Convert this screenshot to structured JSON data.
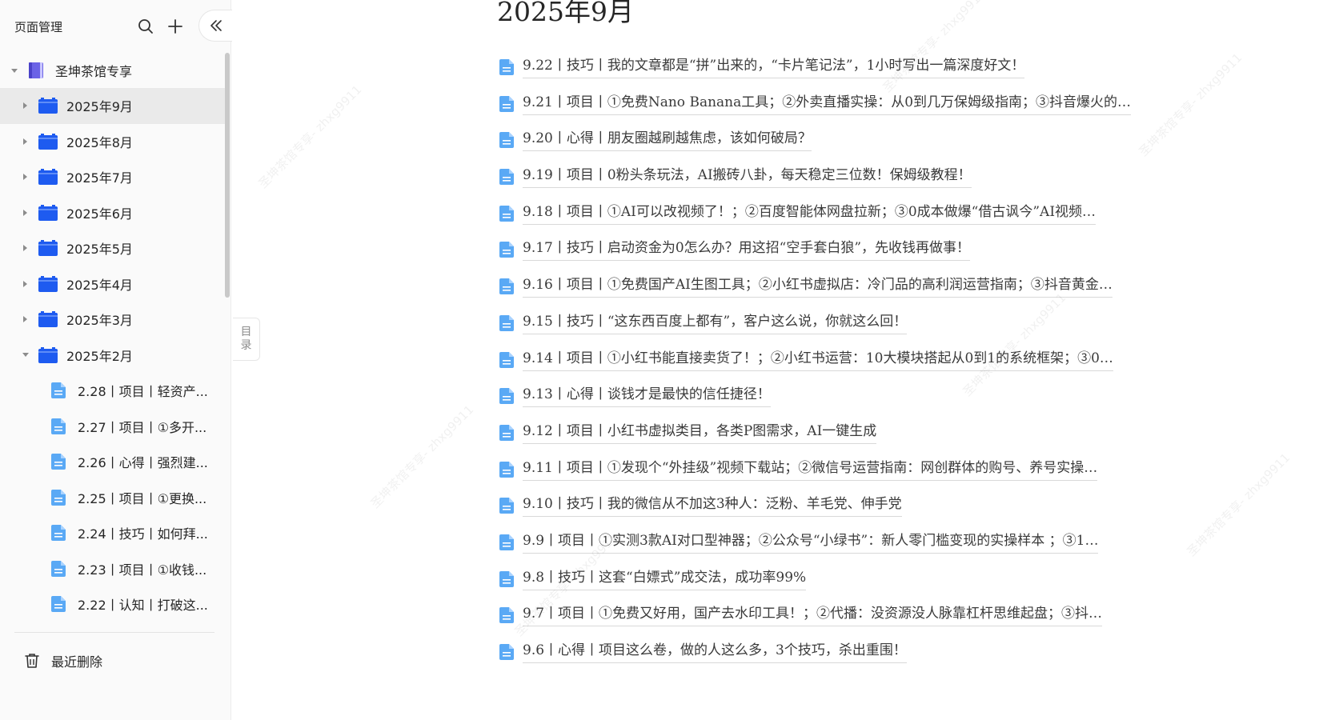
{
  "sidebar": {
    "title": "页面管理",
    "root": {
      "label": "圣坤茶馆专享"
    },
    "folders": [
      {
        "label": "2025年9月"
      },
      {
        "label": "2025年8月"
      },
      {
        "label": "2025年7月"
      },
      {
        "label": "2025年6月"
      },
      {
        "label": "2025年5月"
      },
      {
        "label": "2025年4月"
      },
      {
        "label": "2025年3月"
      },
      {
        "label": "2025年2月"
      }
    ],
    "children": [
      {
        "label": "2.28丨项目丨轻资产..."
      },
      {
        "label": "2.27丨项目丨①多开..."
      },
      {
        "label": "2.26丨心得丨强烈建..."
      },
      {
        "label": "2.25丨项目丨①更换..."
      },
      {
        "label": "2.24丨技巧丨如何拜..."
      },
      {
        "label": "2.23丨项目丨①收钱..."
      },
      {
        "label": "2.22丨认知丨打破这..."
      }
    ],
    "trash_label": "最近删除"
  },
  "toc_tab": {
    "line1": "目",
    "line2": "录"
  },
  "main": {
    "title": "2025年9月",
    "docs": [
      {
        "text": "9.22丨技巧丨我的文章都是“拼”出来的，“卡片笔记法”，1小时写出一篇深度好文！"
      },
      {
        "text": "9.21丨项目丨①免费Nano Banana工具；②外卖直播实操：从0到几万保姆级指南；③抖音爆火的…"
      },
      {
        "text": "9.20丨心得丨朋友圈越刷越焦虑，该如何破局？"
      },
      {
        "text": "9.19丨项目丨0粉头条玩法，AI搬砖八卦，每天稳定三位数！保姆级教程！"
      },
      {
        "text": "9.18丨项目丨①AI可以改视频了！；②百度智能体网盘拉新；③0成本做爆“借古讽今”AI视频…"
      },
      {
        "text": "9.17丨技巧丨启动资金为0怎么办？用这招“空手套白狼”，先收钱再做事！"
      },
      {
        "text": "9.16丨项目丨①免费国产AI生图工具；②小红书虚拟店：冷门品的高利润运营指南；③抖音黄金…"
      },
      {
        "text": "9.15丨技巧丨“这东西百度上都有”，客户这么说，你就这么回！"
      },
      {
        "text": "9.14丨项目丨①小红书能直接卖货了！；②小红书运营：10大模块搭起从0到1的系统框架；③0…"
      },
      {
        "text": "9.13丨心得丨谈钱才是最快的信任捷径！"
      },
      {
        "text": "9.12丨项目丨小红书虚拟类目，各类P图需求，AI一键生成"
      },
      {
        "text": "9.11丨项目丨①发现个“外挂级”视频下载站；②微信号运营指南：网创群体的购号、养号实操…"
      },
      {
        "text": "9.10丨技巧丨我的微信从不加这3种人：泛粉、羊毛党、伸手党"
      },
      {
        "text": "9.9丨项目丨①实测3款AI对口型神器；②公众号“小绿书”：新人零门槛变现的实操样本 ；③1…"
      },
      {
        "text": "9.8丨技巧丨这套“白嫖式”成交法，成功率99%"
      },
      {
        "text": "9.7丨项目丨①免费又好用，国产去水印工具！；②代播：没资源没人脉靠杠杆思维起盘；③抖…"
      },
      {
        "text": "9.6丨心得丨项目这么卷，做的人这么多，3个技巧，杀出重围！"
      }
    ]
  },
  "watermark": {
    "text": "圣坤茶馆专享- zhxg9911"
  },
  "colors": {
    "folder_blue": "#1e5bf0",
    "doc_blue": "#5aa9f5",
    "book_purple": "#6b63e6"
  },
  "icons": [
    "search-icon",
    "plus-icon",
    "double-chevron-left-icon",
    "book-icon",
    "folder-icon",
    "document-icon",
    "trash-icon"
  ]
}
